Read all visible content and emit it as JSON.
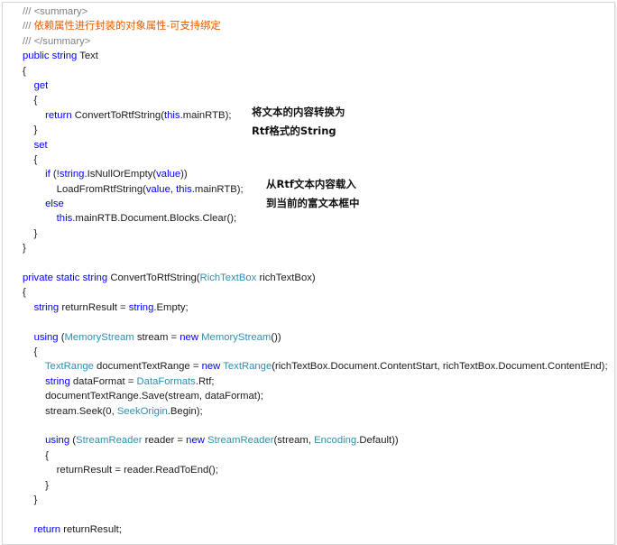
{
  "annotations": {
    "note1_line1": "将文本的内容转换为",
    "note1_line2": "Rtf格式的String",
    "note2_line1": "从Rtf文本内容载入",
    "note2_line2": "到当前的富文本框中"
  },
  "code": [
    [
      {
        "t": "/// ",
        "c": "cmdoc"
      },
      {
        "t": "<summary>",
        "c": "cmdoc"
      }
    ],
    [
      {
        "t": "/// ",
        "c": "cmdoc"
      },
      {
        "t": "依赖属性进行封装的对象属性-可支持绑定",
        "c": "cmdesc"
      }
    ],
    [
      {
        "t": "/// ",
        "c": "cmdoc"
      },
      {
        "t": "</summary>",
        "c": "cmdoc"
      }
    ],
    [
      {
        "t": "public",
        "c": "kw"
      },
      {
        "t": " "
      },
      {
        "t": "string",
        "c": "kw"
      },
      {
        "t": " Text"
      }
    ],
    [
      {
        "t": "{"
      }
    ],
    [
      {
        "t": "    "
      },
      {
        "t": "get",
        "c": "kw"
      }
    ],
    [
      {
        "t": "    {"
      }
    ],
    [
      {
        "t": "        "
      },
      {
        "t": "return",
        "c": "kw"
      },
      {
        "t": " ConvertToRtfString("
      },
      {
        "t": "this",
        "c": "kw"
      },
      {
        "t": ".mainRTB);"
      }
    ],
    [
      {
        "t": "    }"
      }
    ],
    [
      {
        "t": "    "
      },
      {
        "t": "set",
        "c": "kw"
      }
    ],
    [
      {
        "t": "    {"
      }
    ],
    [
      {
        "t": "        "
      },
      {
        "t": "if",
        "c": "kw"
      },
      {
        "t": " (!"
      },
      {
        "t": "string",
        "c": "kw"
      },
      {
        "t": ".IsNullOrEmpty("
      },
      {
        "t": "value",
        "c": "kw"
      },
      {
        "t": "))"
      }
    ],
    [
      {
        "t": "            LoadFromRtfString("
      },
      {
        "t": "value",
        "c": "kw"
      },
      {
        "t": ", "
      },
      {
        "t": "this",
        "c": "kw"
      },
      {
        "t": ".mainRTB);"
      }
    ],
    [
      {
        "t": "        "
      },
      {
        "t": "else",
        "c": "kw"
      }
    ],
    [
      {
        "t": "            "
      },
      {
        "t": "this",
        "c": "kw"
      },
      {
        "t": ".mainRTB.Document.Blocks.Clear();"
      }
    ],
    [
      {
        "t": "    }"
      }
    ],
    [
      {
        "t": "}"
      }
    ],
    [
      {
        "t": ""
      }
    ],
    [
      {
        "t": "private",
        "c": "kw"
      },
      {
        "t": " "
      },
      {
        "t": "static",
        "c": "kw"
      },
      {
        "t": " "
      },
      {
        "t": "string",
        "c": "kw"
      },
      {
        "t": " ConvertToRtfString("
      },
      {
        "t": "RichTextBox",
        "c": "ty"
      },
      {
        "t": " richTextBox)"
      }
    ],
    [
      {
        "t": "{"
      }
    ],
    [
      {
        "t": "    "
      },
      {
        "t": "string",
        "c": "kw"
      },
      {
        "t": " returnResult = "
      },
      {
        "t": "string",
        "c": "kw"
      },
      {
        "t": ".Empty;"
      }
    ],
    [
      {
        "t": ""
      }
    ],
    [
      {
        "t": "    "
      },
      {
        "t": "using",
        "c": "kw"
      },
      {
        "t": " ("
      },
      {
        "t": "MemoryStream",
        "c": "ty"
      },
      {
        "t": " stream = "
      },
      {
        "t": "new",
        "c": "kw"
      },
      {
        "t": " "
      },
      {
        "t": "MemoryStream",
        "c": "ty"
      },
      {
        "t": "())"
      }
    ],
    [
      {
        "t": "    {"
      }
    ],
    [
      {
        "t": "        "
      },
      {
        "t": "TextRange",
        "c": "ty"
      },
      {
        "t": " documentTextRange = "
      },
      {
        "t": "new",
        "c": "kw"
      },
      {
        "t": " "
      },
      {
        "t": "TextRange",
        "c": "ty"
      },
      {
        "t": "(richTextBox.Document.ContentStart, richTextBox.Document.ContentEnd);"
      }
    ],
    [
      {
        "t": "        "
      },
      {
        "t": "string",
        "c": "kw"
      },
      {
        "t": " dataFormat = "
      },
      {
        "t": "DataFormats",
        "c": "ty"
      },
      {
        "t": ".Rtf;"
      }
    ],
    [
      {
        "t": "        documentTextRange.Save(stream, dataFormat);"
      }
    ],
    [
      {
        "t": "        stream.Seek(0, "
      },
      {
        "t": "SeekOrigin",
        "c": "ty"
      },
      {
        "t": ".Begin);"
      }
    ],
    [
      {
        "t": ""
      }
    ],
    [
      {
        "t": "        "
      },
      {
        "t": "using",
        "c": "kw"
      },
      {
        "t": " ("
      },
      {
        "t": "StreamReader",
        "c": "ty"
      },
      {
        "t": " reader = "
      },
      {
        "t": "new",
        "c": "kw"
      },
      {
        "t": " "
      },
      {
        "t": "StreamReader",
        "c": "ty"
      },
      {
        "t": "(stream, "
      },
      {
        "t": "Encoding",
        "c": "ty"
      },
      {
        "t": ".Default))"
      }
    ],
    [
      {
        "t": "        {"
      }
    ],
    [
      {
        "t": "            returnResult = reader.ReadToEnd();"
      }
    ],
    [
      {
        "t": "        }"
      }
    ],
    [
      {
        "t": "    }"
      }
    ],
    [
      {
        "t": ""
      }
    ],
    [
      {
        "t": "    "
      },
      {
        "t": "return",
        "c": "kw"
      },
      {
        "t": " returnResult;"
      }
    ]
  ]
}
